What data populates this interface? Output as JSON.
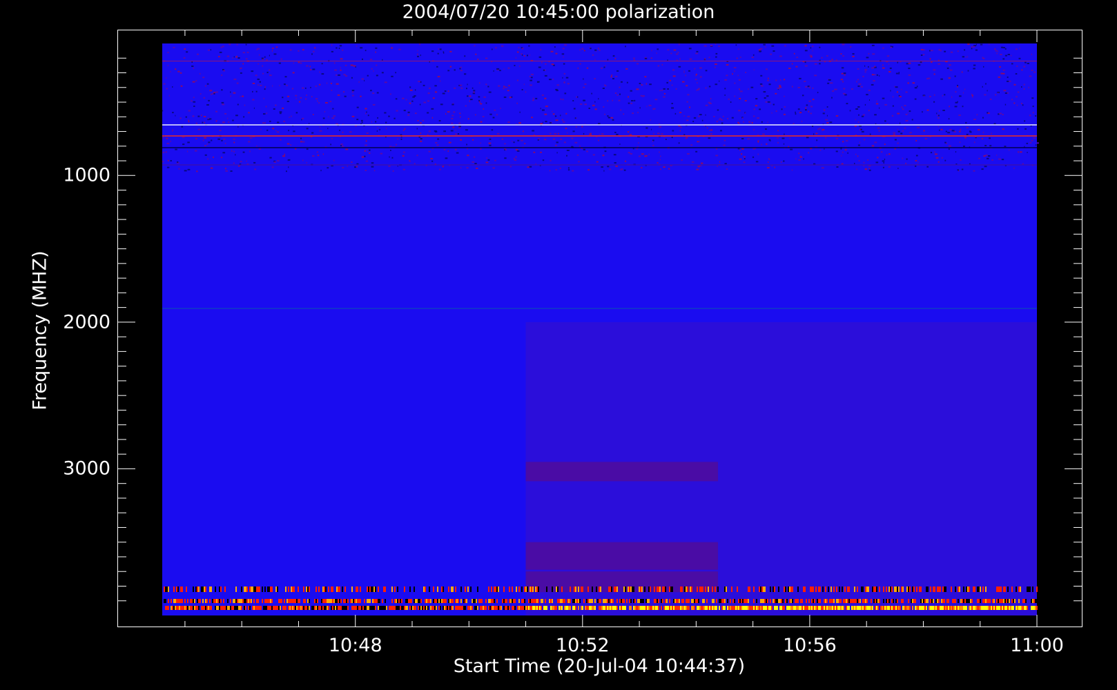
{
  "chart_data": {
    "type": "heatmap",
    "title": "2004/07/20 10:45:00 polarization",
    "xlabel": "Start Time (20-Jul-04 10:44:37)",
    "ylabel": "Frequency (MHZ)",
    "x_ticks": [
      "10:48",
      "10:52",
      "10:56",
      "11:00"
    ],
    "y_ticks": [
      1000,
      2000,
      3000
    ],
    "x_range_minutes_after_10_00": [
      44.6,
      60
    ],
    "y_range_mhz": [
      100,
      4000
    ],
    "y_inverted": true,
    "colormap": [
      "#000000",
      "#0000ff",
      "#ff0000",
      "#ffff00",
      "#ffffff"
    ],
    "features": [
      {
        "description_freq_mhz": [
          3000,
          3900
        ],
        "time_start": "10:51",
        "time_end": "11:00",
        "level": "enhanced"
      },
      {
        "description_freq_mhz": [
          3800,
          3900
        ],
        "time_start": "10:51",
        "time_end": "11:00",
        "level": "strong"
      }
    ]
  }
}
